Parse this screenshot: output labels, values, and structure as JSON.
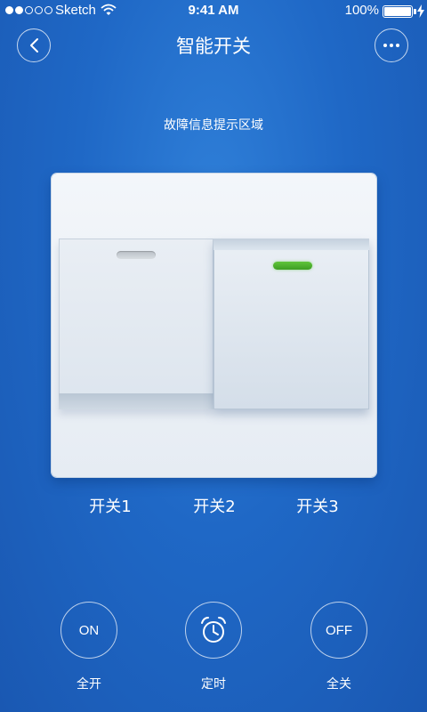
{
  "status_bar": {
    "carrier": "Sketch",
    "time": "9:41 AM",
    "battery": "100%",
    "signal_icon": "signal-dots-icon",
    "wifi_icon": "wifi-icon",
    "battery_icon": "battery-icon",
    "charging_icon": "lightning-icon"
  },
  "nav": {
    "title": "智能开关",
    "back_icon": "chevron-left-icon",
    "more_icon": "more-dots-icon"
  },
  "fault_hint": "故障信息提示区域",
  "switches": [
    {
      "label": "开关1",
      "indicator": "off"
    },
    {
      "label": "开关2",
      "indicator": "on"
    },
    {
      "label": "开关3"
    }
  ],
  "controls": {
    "all_on": {
      "button": "ON",
      "label": "全开"
    },
    "timer": {
      "icon": "alarm-clock-icon",
      "label": "定时"
    },
    "all_off": {
      "button": "OFF",
      "label": "全关"
    }
  },
  "colors": {
    "background": "#2068c6",
    "indicator_on": "#4cb22c",
    "indicator_off": "#c4cad0"
  }
}
